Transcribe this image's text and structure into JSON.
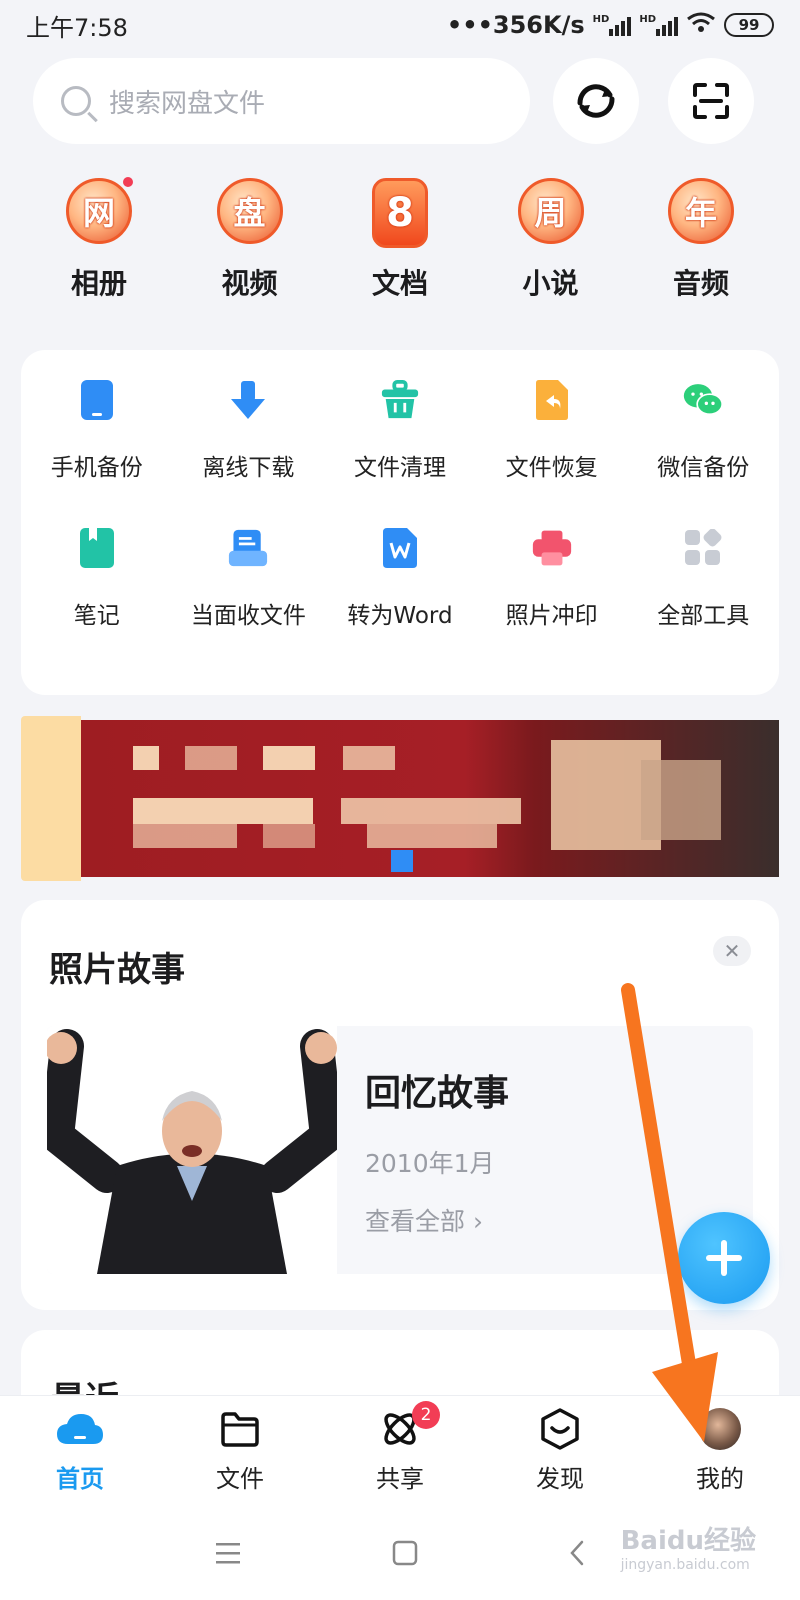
{
  "status_bar": {
    "time": "上午7:58",
    "speed": "•••356K/s",
    "hd1": "HD",
    "hd2": "HD",
    "battery": "99"
  },
  "search": {
    "placeholder": "搜索网盘文件",
    "icon": "search-icon"
  },
  "categories": [
    {
      "badge": "网",
      "label": "相册"
    },
    {
      "badge": "盘",
      "label": "视频"
    },
    {
      "badge": "8",
      "label": "文档"
    },
    {
      "badge": "周",
      "label": "小说"
    },
    {
      "badge": "年",
      "label": "音频"
    }
  ],
  "tools": [
    {
      "label": "手机备份",
      "icon": "phone-backup-icon",
      "color": "#2f8df5"
    },
    {
      "label": "离线下载",
      "icon": "download-icon",
      "color": "#2f8df5"
    },
    {
      "label": "文件清理",
      "icon": "basket-icon",
      "color": "#22c3a6"
    },
    {
      "label": "文件恢复",
      "icon": "restore-icon",
      "color": "#fbb03b"
    },
    {
      "label": "微信备份",
      "icon": "wechat-icon",
      "color": "#2ccf7a"
    },
    {
      "label": "笔记",
      "icon": "note-icon",
      "color": "#22c3a6"
    },
    {
      "label": "当面收文件",
      "icon": "receive-file-icon",
      "color": "#2f8df5"
    },
    {
      "label": "转为Word",
      "icon": "word-icon",
      "color": "#2f8df5"
    },
    {
      "label": "照片冲印",
      "icon": "print-icon",
      "color": "#f2546d"
    },
    {
      "label": "全部工具",
      "icon": "all-tools-icon",
      "color": "#c8ccd4"
    }
  ],
  "story": {
    "title": "照片故事",
    "close": "✕",
    "heading": "回忆故事",
    "date": "2010年1月",
    "link": "查看全部 ›"
  },
  "recent": {
    "title": "最近"
  },
  "nav": [
    {
      "label": "首页",
      "icon": "cloud-home-icon",
      "active": true
    },
    {
      "label": "文件",
      "icon": "folder-icon",
      "active": false
    },
    {
      "label": "共享",
      "icon": "share-atom-icon",
      "active": false,
      "badge": "2"
    },
    {
      "label": "发现",
      "icon": "discover-icon",
      "active": false
    },
    {
      "label": "我的",
      "icon": "avatar",
      "active": false
    }
  ],
  "watermark": {
    "main": "Baidu经验",
    "sub": "jingyan.baidu.com"
  },
  "colors": {
    "accent": "#1a9af0",
    "arrow": "#f7751f",
    "badge": "#f23d55"
  }
}
